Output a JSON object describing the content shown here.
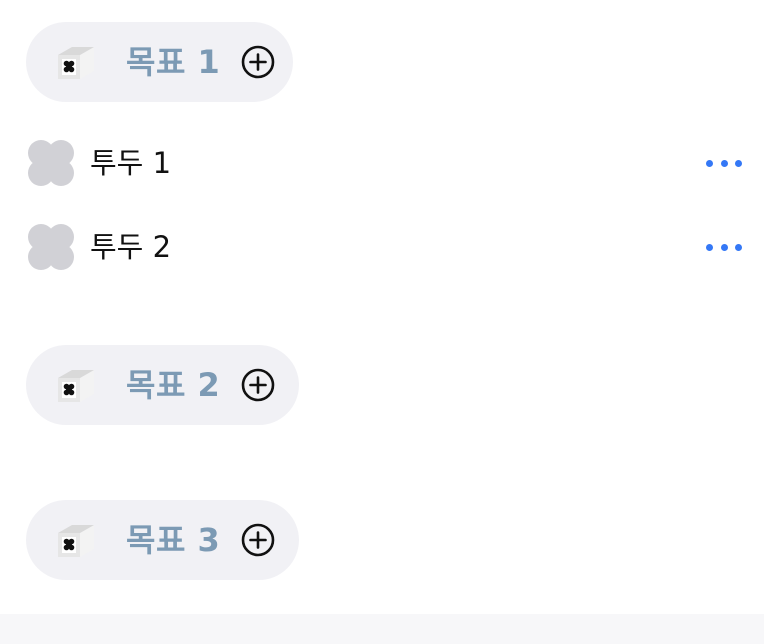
{
  "goals": [
    {
      "title": "목표 1",
      "icon": "box-icon",
      "action_icon": "plus-circle-icon"
    },
    {
      "title": "목표 2",
      "icon": "box-icon",
      "action_icon": "plus-circle-icon"
    },
    {
      "title": "목표 3",
      "icon": "box-icon",
      "action_icon": "plus-circle-icon"
    }
  ],
  "todos": [
    {
      "label": "투두 1",
      "check_icon": "clover-checkbox-icon",
      "menu_icon": "more-icon"
    },
    {
      "label": "투두 2",
      "check_icon": "clover-checkbox-icon",
      "menu_icon": "more-icon"
    }
  ],
  "colors": {
    "goal_pill_bg": "#f1f1f5",
    "goal_title": "#7c9ab4",
    "checkbox_gray": "#d1d1d6",
    "more_blue": "#3478f6",
    "todo_text": "#111111"
  }
}
